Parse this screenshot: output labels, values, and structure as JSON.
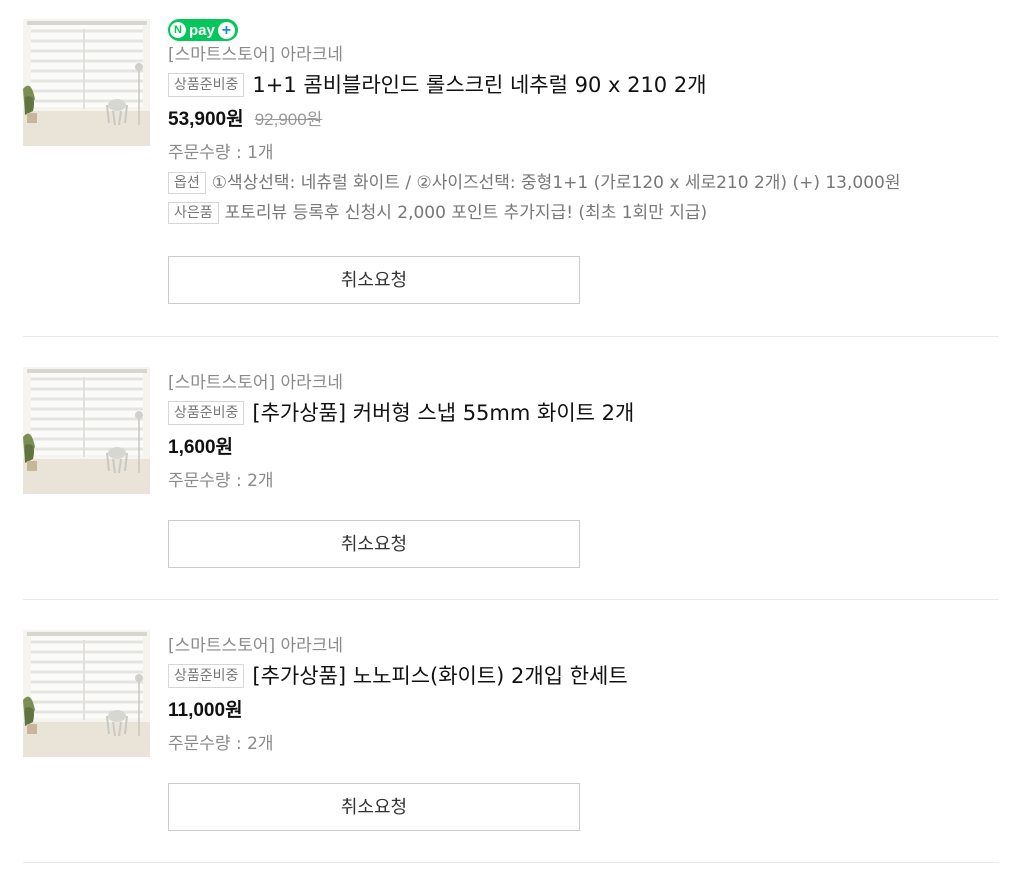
{
  "colors": {
    "npay_green": "#03c75a",
    "badge_border": "#d6d6d6",
    "muted_text": "#8a8a8a"
  },
  "items": [
    {
      "npay": {
        "n": "N",
        "label": "pay",
        "plus": "+"
      },
      "store": "[스마트스토어] 아라크네",
      "status": "상품준비중",
      "title": "1+1 콤비블라인드 롤스크린 네추럴 90 x 210 2개",
      "price": "53,900원",
      "original_price": "92,900원",
      "quantity": "주문수량 : 1개",
      "option_label": "옵션",
      "option_text": "①색상선택: 네츄럴 화이트 / ②사이즈선택: 중형1+1 (가로120 x 세로210 2개) (+) 13,000원",
      "gift_label": "사은품",
      "gift_text": "포토리뷰 등록후 신청시 2,000 포인트 추가지급! (최초 1회만 지급)",
      "cancel_label": "취소요청",
      "thumb_icon": "product-thumbnail-blinds"
    },
    {
      "store": "[스마트스토어] 아라크네",
      "status": "상품준비중",
      "title": "[추가상품] 커버형 스냅 55mm 화이트 2개",
      "price": "1,600원",
      "quantity": "주문수량 : 2개",
      "cancel_label": "취소요청",
      "thumb_icon": "product-thumbnail-blinds"
    },
    {
      "store": "[스마트스토어] 아라크네",
      "status": "상품준비중",
      "title": "[추가상품] 노노피스(화이트) 2개입 한세트",
      "price": "11,000원",
      "quantity": "주문수량 : 2개",
      "cancel_label": "취소요청",
      "thumb_icon": "product-thumbnail-blinds"
    }
  ]
}
